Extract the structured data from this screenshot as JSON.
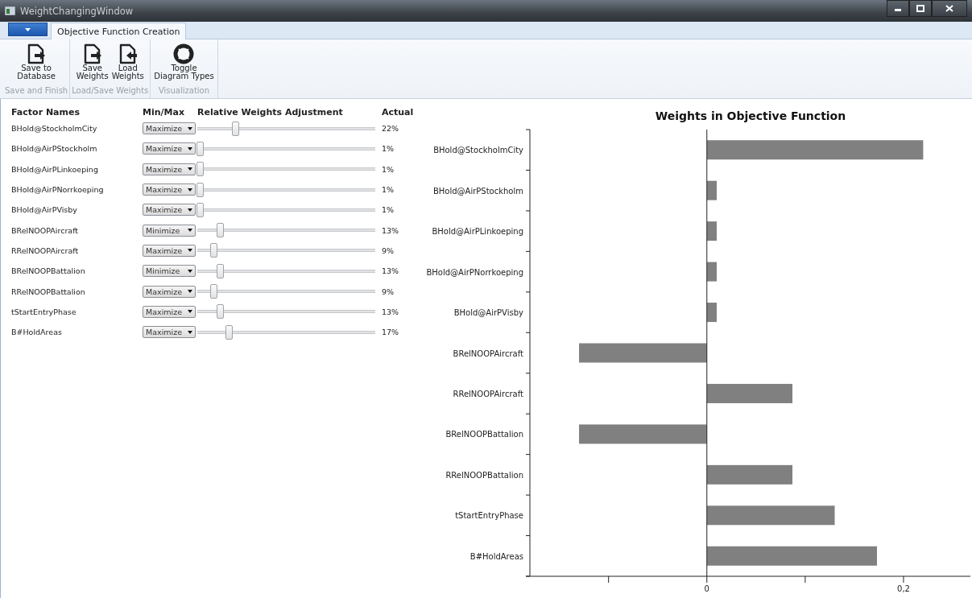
{
  "window": {
    "title": "WeightChangingWindow"
  },
  "ribbon": {
    "tabs": [
      {
        "label": "Objective Function Creation",
        "selected": true
      }
    ],
    "groups": [
      {
        "label": "Save and Finish",
        "buttons": [
          {
            "label": "Save to\nDatabase",
            "kind": "export"
          }
        ]
      },
      {
        "label": "Load/Save Weights",
        "buttons": [
          {
            "label": "Save\nWeights",
            "kind": "export"
          },
          {
            "label": "Load\nWeights",
            "kind": "import"
          }
        ]
      },
      {
        "label": "Visualization",
        "buttons": [
          {
            "label": "Toggle\nDiagram Types",
            "kind": "toggle"
          }
        ]
      }
    ]
  },
  "table": {
    "columns": [
      "Factor Names",
      "Min/Max",
      "Relative Weights Adjustment",
      "Actual"
    ],
    "rows": [
      {
        "name": "BHold@StockholmCity",
        "mode": "Maximize",
        "level": 0.21,
        "actual": "22%"
      },
      {
        "name": "BHold@AirPStockholm",
        "mode": "Maximize",
        "level": 0.0,
        "actual": "1%"
      },
      {
        "name": "BHold@AirPLinkoeping",
        "mode": "Maximize",
        "level": 0.0,
        "actual": "1%"
      },
      {
        "name": "BHold@AirPNorrkoeping",
        "mode": "Maximize",
        "level": 0.0,
        "actual": "1%"
      },
      {
        "name": "BHold@AirPVisby",
        "mode": "Maximize",
        "level": 0.0,
        "actual": "1%"
      },
      {
        "name": "BRelNOOPAircraft",
        "mode": "Minimize",
        "level": 0.12,
        "actual": "13%"
      },
      {
        "name": "RRelNOOPAircraft",
        "mode": "Maximize",
        "level": 0.08,
        "actual": "9%"
      },
      {
        "name": "BRelNOOPBattalion",
        "mode": "Minimize",
        "level": 0.12,
        "actual": "13%"
      },
      {
        "name": "RRelNOOPBattalion",
        "mode": "Maximize",
        "level": 0.08,
        "actual": "9%"
      },
      {
        "name": "tStartEntryPhase",
        "mode": "Maximize",
        "level": 0.12,
        "actual": "13%"
      },
      {
        "name": "B#HoldAreas",
        "mode": "Maximize",
        "level": 0.17,
        "actual": "17%"
      }
    ]
  },
  "chart": {
    "chart_data": {
      "type": "bar",
      "orientation": "horizontal",
      "title": "Weights in Objective Function",
      "categories": [
        "BHold@StockholmCity",
        "BHold@AirPStockholm",
        "BHold@AirPLinkoeping",
        "BHold@AirPNorrkoeping",
        "BHold@AirPVisby",
        "BRelNOOPAircraft",
        "RRelNOOPAircraft",
        "BRelNOOPBattalion",
        "RRelNOOPBattalion",
        "tStartEntryPhase",
        "B#HoldAreas"
      ],
      "values": [
        0.22,
        0.01,
        0.01,
        0.01,
        0.01,
        -0.13,
        0.087,
        -0.13,
        0.087,
        0.13,
        0.173
      ],
      "xlim": [
        -0.18,
        0.268
      ],
      "xticks": [
        {
          "value": 0,
          "label": "0"
        },
        {
          "value": 0.2,
          "label": "0,2"
        }
      ]
    }
  }
}
